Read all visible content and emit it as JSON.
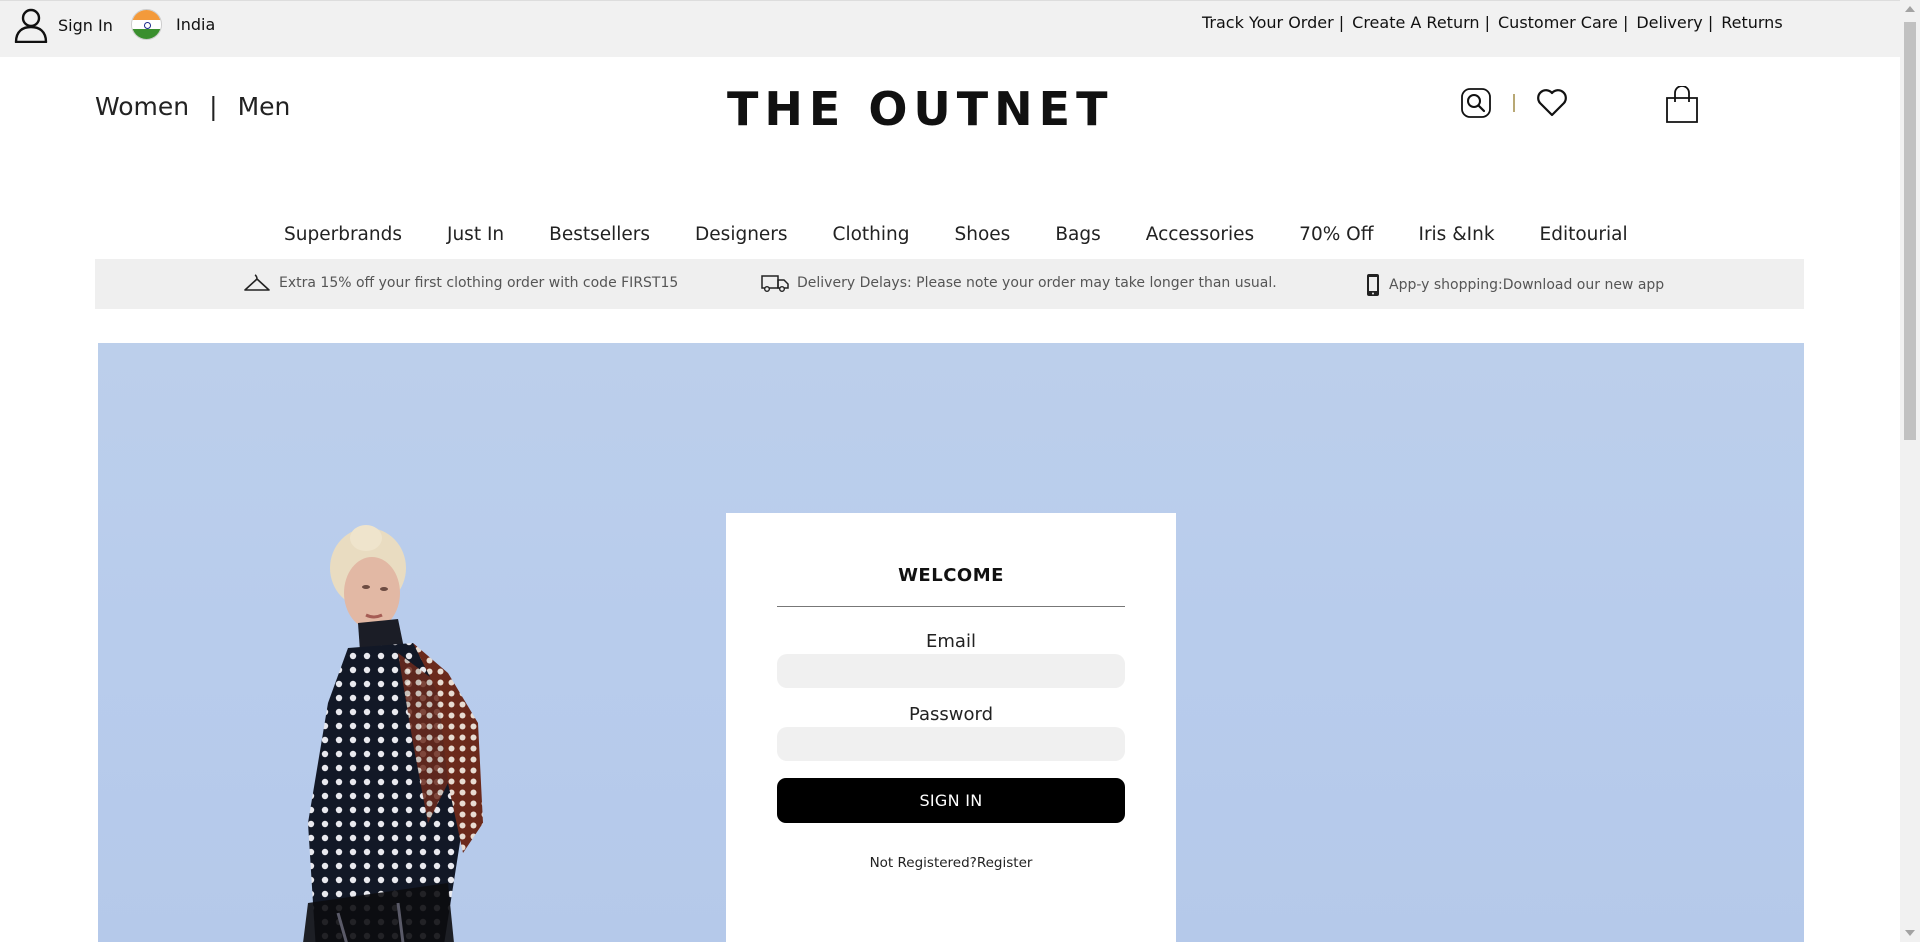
{
  "topbar": {
    "signin_label": "Sign In",
    "country_label": "India",
    "links": [
      "Track Your Order |",
      "Create A Return |",
      "Customer Care |",
      "Delivery |",
      "Returns"
    ]
  },
  "header": {
    "women_label": "Women",
    "separator": "|",
    "men_label": "Men",
    "logo_text": "THE OUTNET"
  },
  "nav": {
    "items": [
      "Superbrands",
      "Just In",
      "Bestsellers",
      "Designers",
      "Clothing",
      "Shoes",
      "Bags",
      "Accessories",
      "70% Off",
      "Iris &Ink",
      "Editourial"
    ]
  },
  "promo": {
    "items": [
      {
        "icon": "hanger-icon",
        "text": "Extra 15% off your first clothing order with code FIRST15"
      },
      {
        "icon": "delivery-truck-icon",
        "text": "Delivery Delays: Please note your order may take longer than usual."
      },
      {
        "icon": "mobile-phone-icon",
        "text": "App-y shopping:Download our new app"
      }
    ]
  },
  "login": {
    "title": "WELCOME",
    "email_label": "Email",
    "email_value": "",
    "password_label": "Password",
    "password_value": "",
    "submit_label": "SIGN IN",
    "register_prompt": "Not Registered?",
    "register_link": "Register"
  },
  "colors": {
    "hero_bg": "#bccfeb",
    "topbar_bg": "#f1f1f1",
    "promo_bg": "#efefef",
    "button_bg": "#000000"
  }
}
